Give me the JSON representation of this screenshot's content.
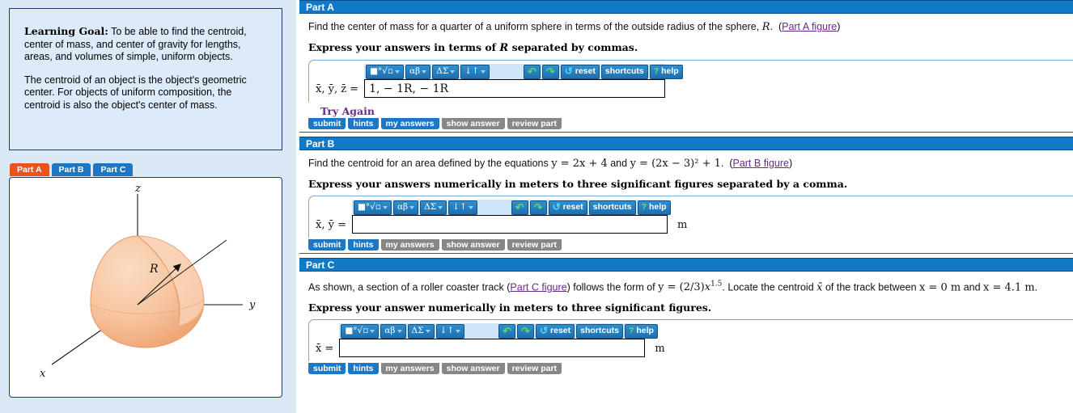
{
  "left_panel": {
    "learning_goal": {
      "label": "Learning Goal:",
      "paragraph1": " To be able to find the centroid, center of mass, and center of gravity for lengths, areas, and volumes of simple, uniform objects.",
      "paragraph2": "The centroid of an object is the object's geometric center. For objects of uniform composition, the centroid is also the object's center of mass."
    },
    "tabs": [
      {
        "label": "Part A",
        "active": true
      },
      {
        "label": "Part B",
        "active": false
      },
      {
        "label": "Part C",
        "active": false
      }
    ],
    "figure": {
      "axis_x": "x",
      "axis_y": "y",
      "axis_z": "z",
      "radius_label": "R",
      "shape_color": "#f5b183",
      "description": "quarter of a uniform sphere with x, y, z axes and radius R"
    }
  },
  "colors": {
    "header_blue": "#1179c6",
    "tab_active": "#e8551c",
    "tab_inactive": "#1d77c4",
    "link_purple": "#6a2a8a",
    "panel_bg": "#dbe9f7",
    "button_on": "#1d77c4",
    "button_off": "#878787"
  },
  "toolbar": {
    "buttons": [
      {
        "name": "sqrt-exponent-menu",
        "glyph": "■°√▫"
      },
      {
        "name": "greek-letters-menu",
        "glyph": "αβ"
      },
      {
        "name": "capital-greek-menu",
        "glyph": "ΔΣ"
      },
      {
        "name": "arrows-menu",
        "glyph": "↓↑"
      }
    ],
    "undo_label": "↶",
    "redo_label": "↷",
    "reset_label": "reset",
    "shortcuts_label": "shortcuts",
    "help_label": "help",
    "help_glyph": "?",
    "reset_glyph": "↺"
  },
  "action_buttons": {
    "submit": "submit",
    "hints": "hints",
    "my_answers": "my answers",
    "show_answer": "show answer",
    "review_part": "review part"
  },
  "parts": [
    {
      "id": "part-a",
      "header": "Part A",
      "question_pre": "Find the center of mass for a quarter of a uniform sphere in terms of the outside radius of the sphere, ",
      "question_var": "R",
      "question_post": ".",
      "figure_link": "Part A figure",
      "prompt_pre": "Express your answers in terms of ",
      "prompt_var": "R",
      "prompt_post": " separated by commas.",
      "answer_label": "x̄, ȳ, z̄  =",
      "answer_value": "1, − 1R, − 1R",
      "answer_placeholder": "",
      "unit": "",
      "feedback": "Try Again",
      "buttons_enabled": [
        "submit",
        "hints",
        "my answers"
      ],
      "buttons_disabled": [
        "show answer",
        "review part"
      ]
    },
    {
      "id": "part-b",
      "header": "Part B",
      "question_pre": "Find the centroid for an area defined by the equations ",
      "equation1": "y = 2x + 4",
      "question_mid": " and ",
      "equation2": "y = (2x − 3)² + 1",
      "question_post": ".",
      "figure_link": "Part B figure",
      "prompt": "Express your answers numerically in meters to three significant figures separated by a comma.",
      "answer_label": "x̄, ȳ  =",
      "answer_value": "",
      "answer_placeholder": "",
      "unit": "m",
      "feedback": "",
      "buttons_enabled": [
        "submit",
        "hints"
      ],
      "buttons_disabled": [
        "my answers",
        "show answer",
        "review part"
      ]
    },
    {
      "id": "part-c",
      "header": "Part C",
      "question_pre": "As shown, a section of a roller coaster track  (",
      "figure_link": "Part C figure",
      "question_mid": ")  follows the form of ",
      "equation1": "y = (2/3)x^1.5",
      "question_post2": ". Locate the centroid ",
      "centroid_var": "x̄",
      "question_post3": " of the track between ",
      "range_start": "x = 0 m",
      "question_and": " and ",
      "range_end": "x = 4.1 m",
      "question_end": ".",
      "prompt": "Express your answer numerically in meters to three significant figures.",
      "answer_label": "x̄  =",
      "answer_value": "",
      "answer_placeholder": "",
      "unit": "m",
      "feedback": "",
      "buttons_enabled": [
        "submit",
        "hints"
      ],
      "buttons_disabled": [
        "my answers",
        "show answer",
        "review part"
      ]
    }
  ]
}
